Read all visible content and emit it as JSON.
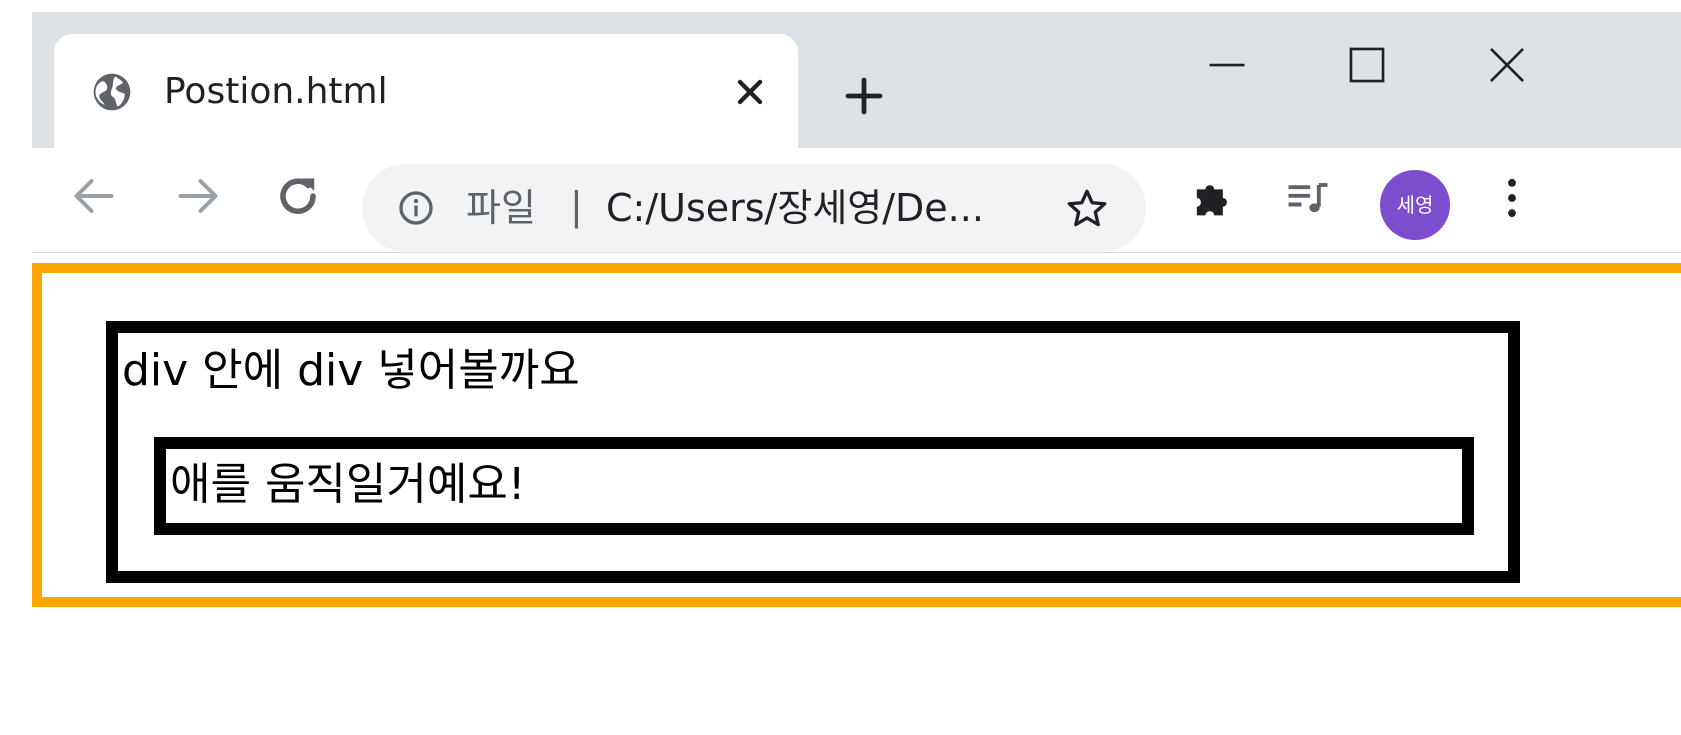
{
  "tab": {
    "title": "Postion.html",
    "favicon": "globe-icon"
  },
  "omnibox": {
    "scheme_label": "파일",
    "separator": "|",
    "url": "C:/Users/장세영/De..."
  },
  "profile": {
    "avatar_label": "세영",
    "avatar_color": "#7c4dcc"
  },
  "page": {
    "outer_border_color": "#ffa500",
    "middle_text": "div 안에 div 넣어볼까요",
    "inner_text": "애를 움직일거예요!"
  }
}
